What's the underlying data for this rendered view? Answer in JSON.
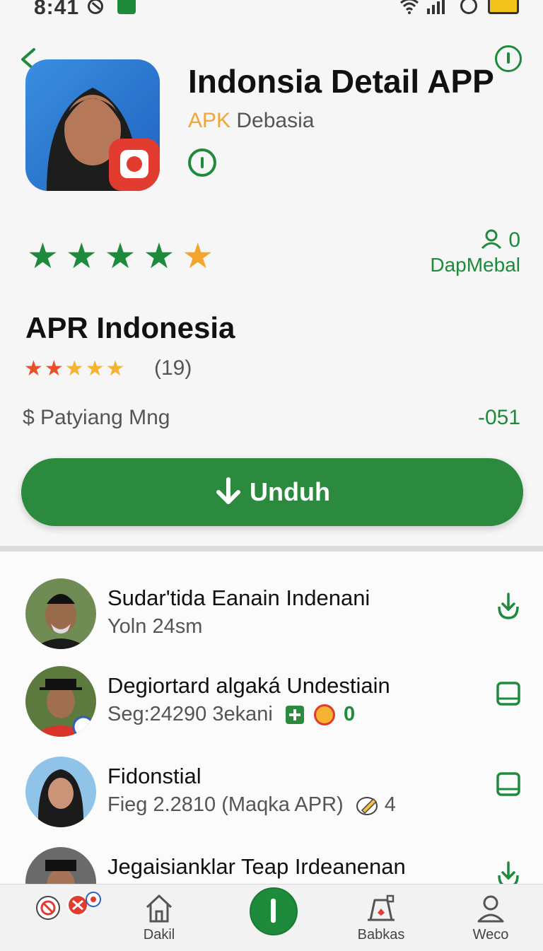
{
  "status_bar": {
    "time": "8:41"
  },
  "app": {
    "title": "Indonsia Detail APP",
    "subtitle_highlight": "APK",
    "subtitle_rest": "Debasia"
  },
  "rating": {
    "stars_filled": 5,
    "developer_count": "0",
    "developer_name": "DapMebal"
  },
  "detail": {
    "section_title": "APR Indonesia",
    "review_count": "(19)",
    "payment_label": "$ Patyiang Mng",
    "price": "-051"
  },
  "download_button": {
    "label": "Unduh"
  },
  "list": [
    {
      "title": "Sudar'tida Eanain Indenani",
      "subtitle": "Yoln 24sm",
      "action": "download"
    },
    {
      "title": "Degiortard algaká Undestiain",
      "subtitle": "Seg:24290 3ekani",
      "badge_count": "0",
      "action": "save"
    },
    {
      "title": "Fidonstial",
      "subtitle": "Fieg 2.2810 (Maqka APR)",
      "badge_count": "4",
      "action": "save"
    },
    {
      "title": "Jegaisianklar Teap Irdeanenan",
      "subtitle": "",
      "action": "download"
    }
  ],
  "bottom_nav": {
    "items": [
      {
        "label": "Dakil",
        "icon": "home-icon"
      },
      {
        "label": "",
        "icon": "center-info-icon"
      },
      {
        "label": "Babkas",
        "icon": "store-icon"
      },
      {
        "label": "Weco",
        "icon": "profile-icon"
      }
    ]
  },
  "colors": {
    "primary_green": "#2b8a3e",
    "accent_orange": "#f4a52e"
  }
}
